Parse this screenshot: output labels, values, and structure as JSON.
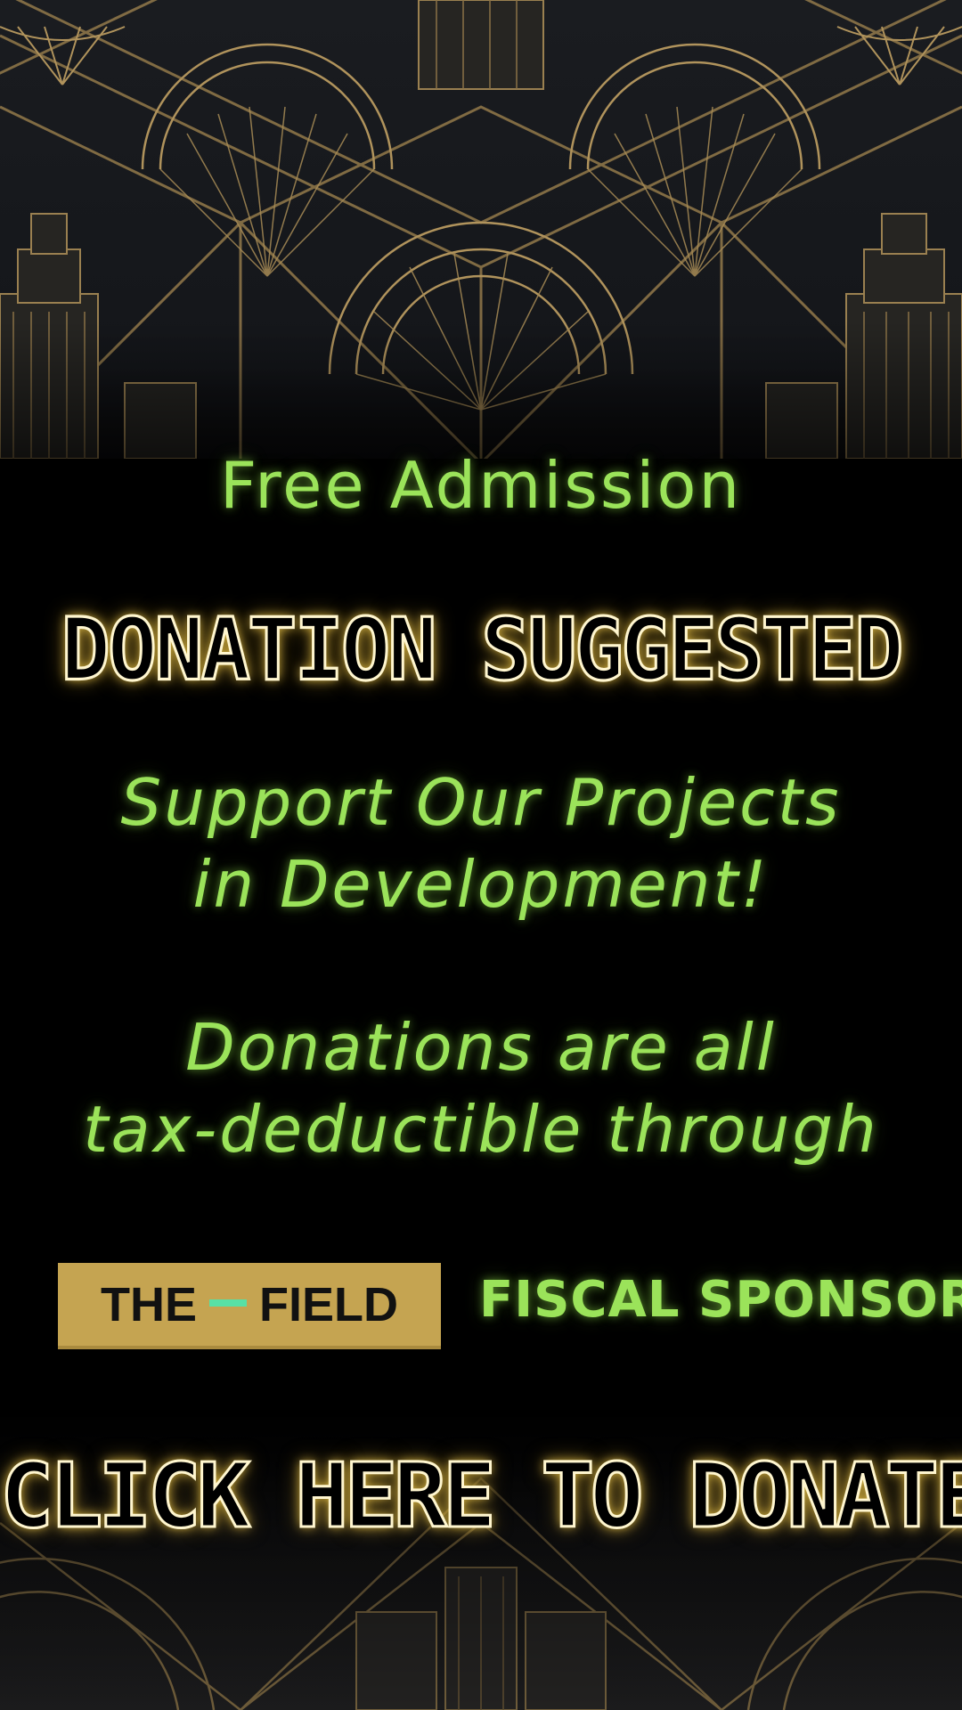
{
  "colors": {
    "background": "#000000",
    "accent_green": "#9be35a",
    "neon_gold": "#ffd650",
    "logo_gold": "#c5a451",
    "logo_dash": "#58e0a5",
    "deco_gold": "#9a8050"
  },
  "icons": {
    "top_art": "art-deco-skyline-pattern",
    "bottom_art": "art-deco-skyline-pattern"
  },
  "headline": "Free Admission",
  "donation_suggested": "DONATION SUGGESTED",
  "support": {
    "line1": "Support Our Projects",
    "line2": "in Development!"
  },
  "tax": {
    "line1": "Donations are all",
    "line2": "tax-deductible through"
  },
  "sponsor": {
    "logo_left": "THE",
    "logo_right": "FIELD",
    "label": "FISCAL SPONSOR"
  },
  "cta": {
    "label": "CLICK HERE TO DONATE"
  }
}
